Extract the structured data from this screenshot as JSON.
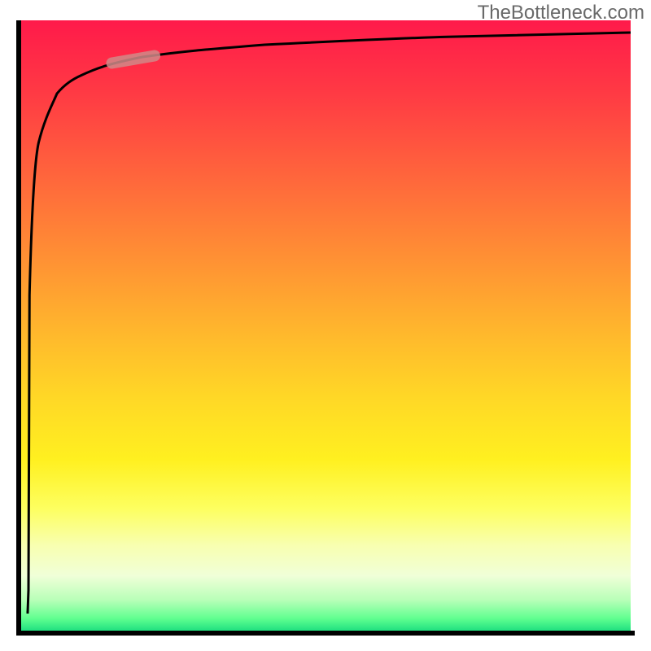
{
  "watermark": "TheBottleneck.com",
  "colors": {
    "axis": "#000000",
    "curve": "#000000",
    "highlight": "#d08a88",
    "gradient_top": "#ff1a4a",
    "gradient_bottom": "#20e080"
  },
  "chart_data": {
    "type": "line",
    "title": "",
    "xlabel": "",
    "ylabel": "",
    "xlim": [
      0,
      100
    ],
    "ylim": [
      0,
      100
    ],
    "x": [
      0,
      1,
      1.5,
      2,
      3,
      4,
      6,
      8,
      10,
      15,
      20,
      30,
      40,
      50,
      60,
      70,
      80,
      90,
      100
    ],
    "values": [
      3,
      3,
      55,
      72,
      80,
      84,
      88,
      90,
      91,
      93,
      94,
      95,
      96,
      96.5,
      97,
      97.3,
      97.6,
      97.8,
      98
    ],
    "highlight_segment": {
      "x_start": 15,
      "x_end": 22,
      "y_start": 93,
      "y_end": 94.2
    },
    "notes": "Steep near-vertical rise near x≈1 followed by asymptotic saturation toward ~98%; short highlighted pill on the rising knee; rainbow vertical heat gradient background."
  }
}
